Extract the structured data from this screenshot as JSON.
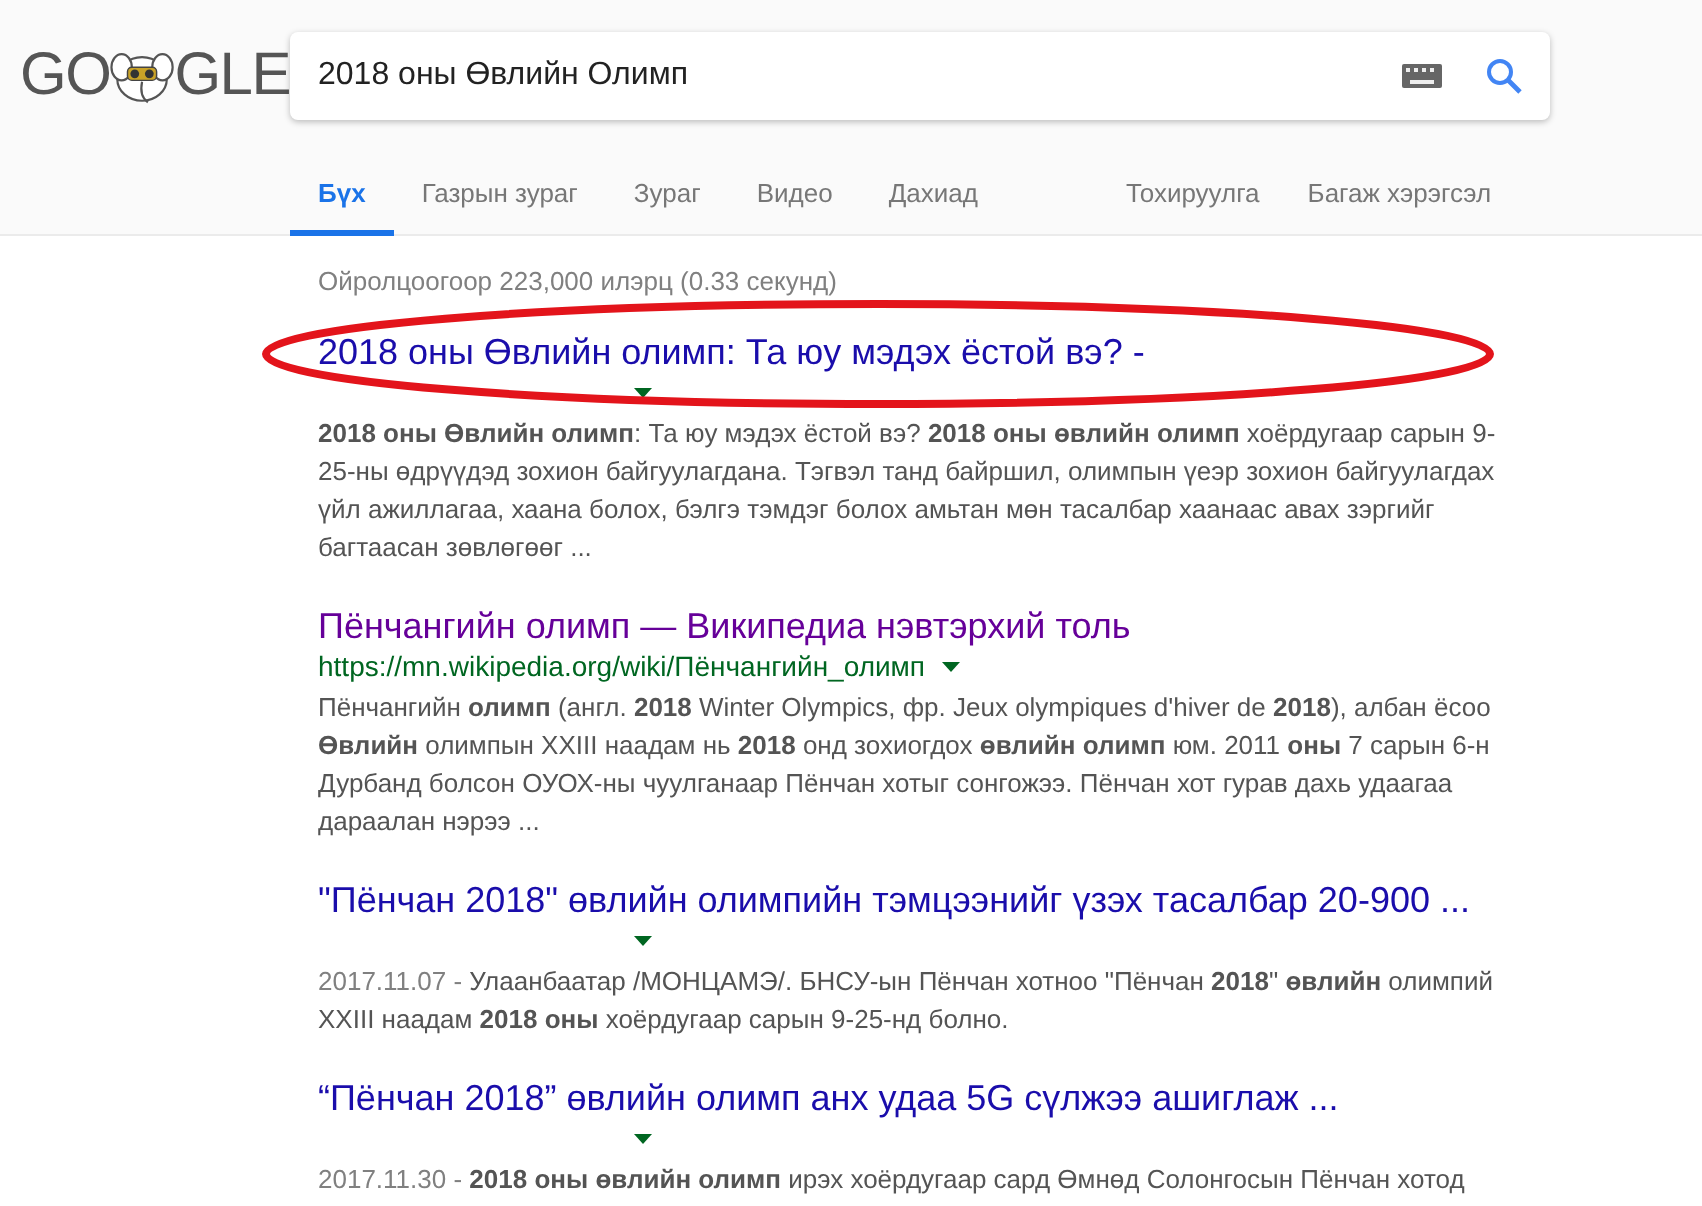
{
  "logo": {
    "left": "GO",
    "right": "GLE"
  },
  "search": {
    "value": "2018 оны Өвлийн Олимп"
  },
  "tabs": [
    {
      "label": "Бүх",
      "selected": true
    },
    {
      "label": "Газрын зураг",
      "selected": false
    },
    {
      "label": "Зураг",
      "selected": false
    },
    {
      "label": "Видео",
      "selected": false
    },
    {
      "label": "Дахиад",
      "selected": false
    }
  ],
  "tools": [
    "Тохируулга",
    "Багаж хэрэгсэл"
  ],
  "result_stats": "Ойролцоогоор 223,000 илэрц (0.33 секунд)",
  "results": [
    {
      "title": "2018 оны Өвлийн олимп: Та юу мэдэх ёстой вэ? -",
      "visited": false,
      "circled": true,
      "lines": [
        "**2018 оны Өвлийн олимп**: Та юу мэдэх ёстой вэ? **2018 оны өвлийн олимп** хоёрдугаар сарын 9-",
        "25-ны өдрүүдэд зохион байгуулагдана. Тэгвэл танд байршил, олимпын үеэр зохион байгуулагдах",
        "үйл ажиллагаа, хаана болох, бэлгэ тэмдэг болох амьтан мөн тасалбар хаанаас авах зэргийг",
        "багтаасан зөвлөгөөг ..."
      ]
    },
    {
      "title": "Пёнчангийн олимп — Википедиа нэвтэрхий толь",
      "url": "https://mn.wikipedia.org/wiki/Пёнчангийн_олимп",
      "visited": true,
      "circled": false,
      "lines": [
        "Пёнчангийн **олимп** (англ. **2018** Winter Olympics, фр. Jeux olympiques d'hiver de **2018**), албан ёсоо",
        "**Өвлийн** олимпын XXIII наадам нь **2018** онд зохиогдох **өвлийн олимп** юм. 2011 **оны** 7 сарын 6-н",
        "Дурбанд болсон ОУОХ-ны чуулганаар Пёнчан хотыг сонгожээ. Пёнчан хот гурав дахь удаагаа",
        "дараалан нэрээ ..."
      ]
    },
    {
      "title": "\"Пёнчан 2018\" өвлийн олимпийн тэмцээнийг үзэх тасалбар 20-900 ...",
      "visited": false,
      "circled": false,
      "date": "2017.11.07 -",
      "lines": [
        "Улаанбаатар /МОНЦАМЭ/. БНСУ-ын Пёнчан хотноо \"Пёнчан **2018**\" **өвлийн** олимпий",
        "XXIII наадам **2018 оны** хоёрдугаар сарын 9-25-нд болно."
      ]
    },
    {
      "title": "“Пёнчан 2018” өвлийн олимп анх удаа 5G сүлжээ ашиглаж ...",
      "visited": false,
      "circled": false,
      "date": "2017.11.30 -",
      "lines": [
        "**2018 оны өвлийн олимп** ирэх хоёрдугаар сард Өмнөд Солонгосын Пёнчан хотод"
      ]
    }
  ]
}
